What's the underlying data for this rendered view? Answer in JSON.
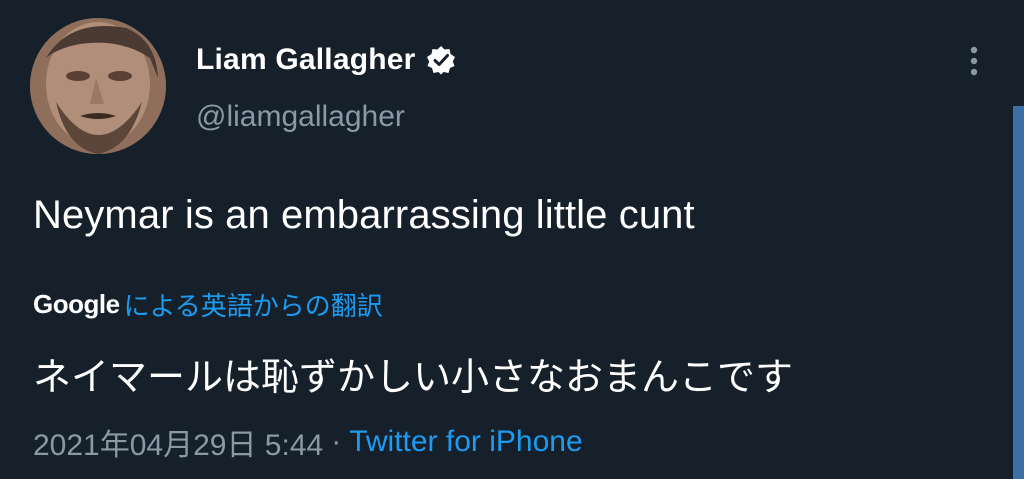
{
  "author": {
    "display_name": "Liam Gallagher",
    "handle": "@liamgallagher",
    "verified": true
  },
  "tweet": {
    "text": "Neymar is an embarrassing little cunt",
    "translation": {
      "provider": "Google",
      "label": "による英語からの翻訳",
      "text": "ネイマールは恥ずかしい小さなおまんこです"
    },
    "timestamp": "2021年04月29日 5:44",
    "separator": "·",
    "source": "Twitter for iPhone"
  },
  "icons": {
    "verified": "verified-badge-icon",
    "more": "more-vertical-icon"
  },
  "colors": {
    "background": "#15202b",
    "accent": "#1d9bf0",
    "secondary_text": "#8b98a5"
  }
}
